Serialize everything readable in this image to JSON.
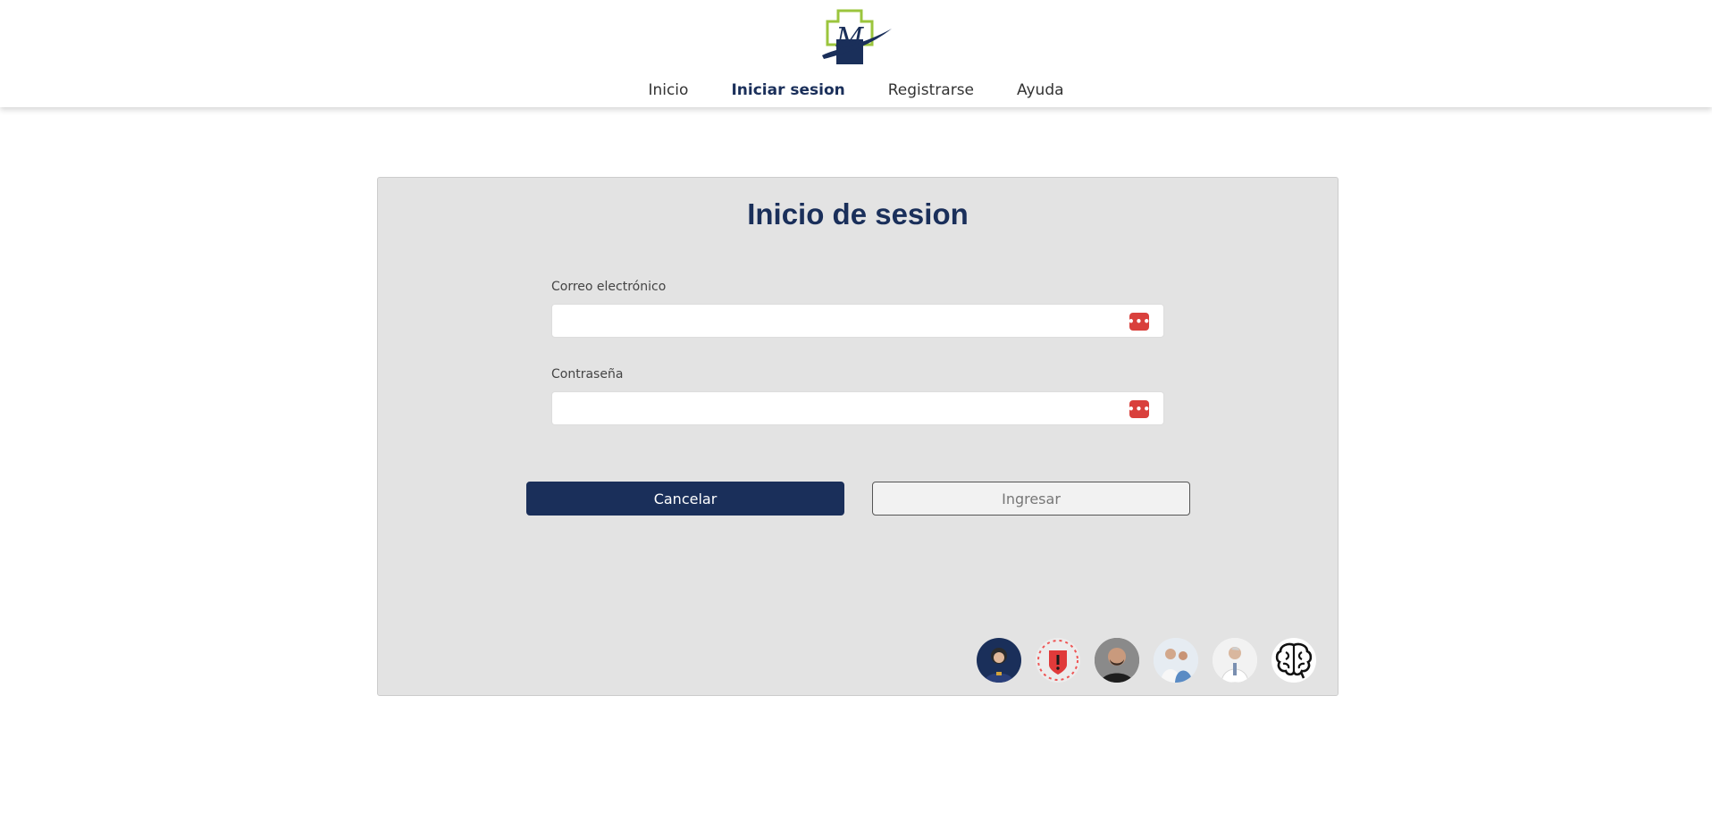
{
  "header": {
    "logo_letter": "M",
    "nav": [
      {
        "label": "Inicio"
      },
      {
        "label": "Iniciar sesion"
      },
      {
        "label": "Registrarse"
      },
      {
        "label": "Ayuda"
      }
    ]
  },
  "login": {
    "title": "Inicio de sesion",
    "email_label": "Correo electrónico",
    "email_value": "",
    "password_label": "Contraseña",
    "password_value": "",
    "cancel_label": "Cancelar",
    "submit_label": "Ingresar"
  },
  "avatars": [
    {
      "icon": "avatar-photo-icon"
    },
    {
      "icon": "alert-icon"
    },
    {
      "icon": "avatar-photo-icon"
    },
    {
      "icon": "doctors-photo-icon"
    },
    {
      "icon": "doctor-photo-icon"
    },
    {
      "icon": "brain-icon"
    }
  ],
  "colors": {
    "brand_navy": "#1a2f5a",
    "brand_green": "#9bc53d",
    "card_bg": "#e3e3e3",
    "password_icon": "#d9403c"
  }
}
